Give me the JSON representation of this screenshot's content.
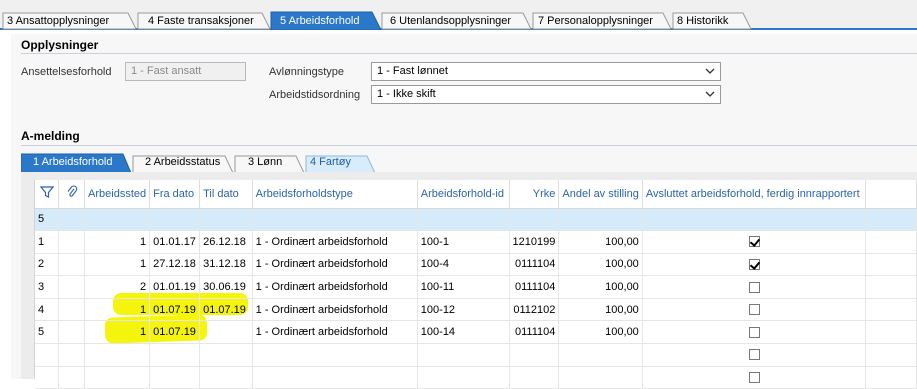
{
  "top_tabs": [
    {
      "label": "3 Ansattopplysninger",
      "active": false
    },
    {
      "label": "4 Faste transaksjoner",
      "active": false
    },
    {
      "label": "5 Arbeidsforhold",
      "active": true
    },
    {
      "label": "6 Utenlandsopplysninger",
      "active": false
    },
    {
      "label": "7 Personalopplysninger",
      "active": false
    },
    {
      "label": "8 Historikk",
      "active": false
    }
  ],
  "opplysninger": {
    "title": "Opplysninger",
    "ansettelsesforhold_label": "Ansettelsesforhold",
    "ansettelsesforhold_value": "1 - Fast ansatt",
    "avlonningstype_label": "Avlønningstype",
    "avlonningstype_value": "1 - Fast lønnet",
    "arbeidstidsordning_label": "Arbeidstidsordning",
    "arbeidstidsordning_value": "1 - Ikke skift"
  },
  "amelding": {
    "title": "A-melding",
    "sub_tabs": [
      {
        "label": "1 Arbeidsforhold",
        "active": true
      },
      {
        "label": "2 Arbeidsstatus",
        "active": false
      },
      {
        "label": "3 Lønn",
        "active": false
      },
      {
        "label": "4 Fartøy",
        "active": false
      }
    ]
  },
  "grid": {
    "icons": {
      "filter": "filter-icon",
      "attachment": "paperclip-icon"
    },
    "columns": [
      "Arbeidssted",
      "Fra dato",
      "Til dato",
      "Arbeidsforholdstype",
      "Arbeidsforhold-id",
      "Yrke",
      "Andel av stilling",
      "Avsluttet arbeidsforhold, ferdig innrapportert"
    ],
    "new_row_count": "5",
    "rows": [
      {
        "num": "1",
        "arbeidssted": "1",
        "fra": "01.01.17",
        "til": "26.12.18",
        "type": "1 - Ordinært arbeidsforhold",
        "id": "100-1",
        "yrke": "1210199",
        "andel": "100,00",
        "avsluttet": true
      },
      {
        "num": "2",
        "arbeidssted": "1",
        "fra": "27.12.18",
        "til": "31.12.18",
        "type": "1 - Ordinært arbeidsforhold",
        "id": "100-4",
        "yrke": "0111104",
        "andel": "100,00",
        "avsluttet": true
      },
      {
        "num": "3",
        "arbeidssted": "2",
        "fra": "01.01.19",
        "til": "30.06.19",
        "type": "1 - Ordinært arbeidsforhold",
        "id": "100-11",
        "yrke": "0111104",
        "andel": "100,00",
        "avsluttet": false
      },
      {
        "num": "4",
        "arbeidssted": "1",
        "fra": "01.07.19",
        "til": "01.07.19",
        "type": "1 - Ordinært arbeidsforhold",
        "id": "100-12",
        "yrke": "0112102",
        "andel": "100,00",
        "avsluttet": false
      },
      {
        "num": "5",
        "arbeidssted": "1",
        "fra": "01.07.19",
        "til": "",
        "type": "1 - Ordinært arbeidsforhold",
        "id": "100-14",
        "yrke": "0111104",
        "andel": "100,00",
        "avsluttet": false
      }
    ],
    "highlight_color": "#f6f600",
    "accent_color": "#2b78c8"
  }
}
